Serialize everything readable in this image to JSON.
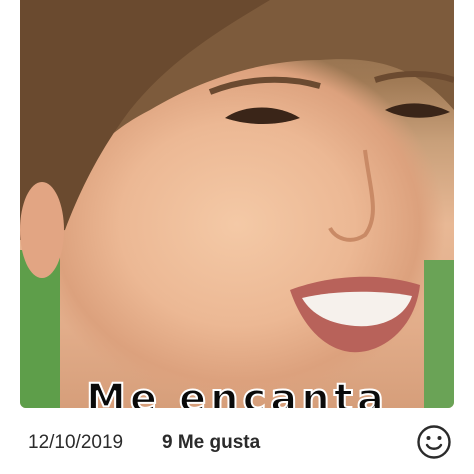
{
  "post": {
    "image_alt": "Close-up photo of a smiling man",
    "caption_overlay": "Me encanta",
    "date": "12/10/2019",
    "likes_label": "9 Me gusta"
  },
  "icons": {
    "reaction": "smiley-face-icon"
  },
  "colors": {
    "text": "#2b2b2b",
    "background": "#ffffff"
  }
}
